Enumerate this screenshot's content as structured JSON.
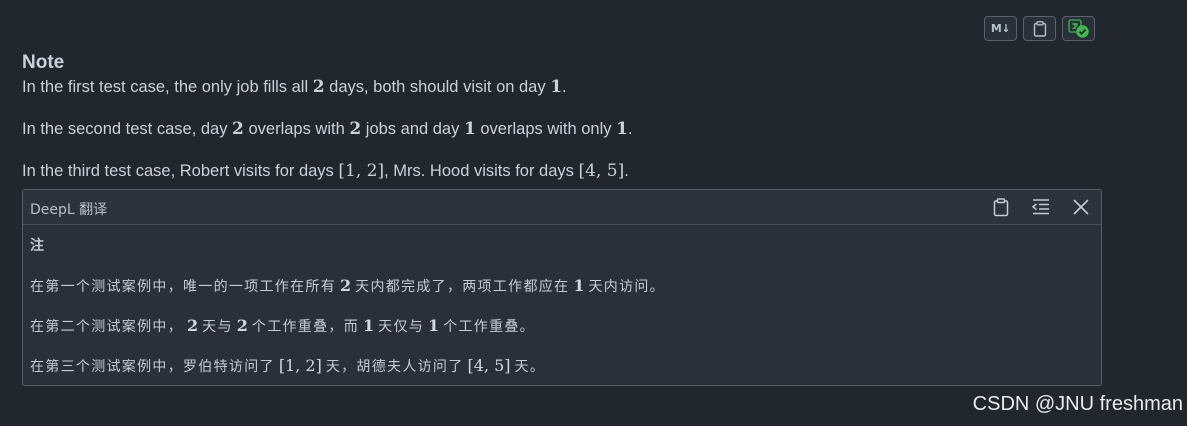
{
  "toolbar": {
    "markdown_label": "M↓",
    "copy_icon": "clipboard-icon",
    "translate_icon": "translate-check-icon"
  },
  "note": {
    "title": "Note",
    "p1": {
      "text_a": "In the first test case, the only job fills all ",
      "math_a": "2",
      "text_b": " days, both should visit on day ",
      "math_b": "1",
      "text_c": "."
    },
    "p2": {
      "text_a": "In the second test case, day ",
      "math_a": "2",
      "text_b": " overlaps with ",
      "math_b": "2",
      "text_c": " jobs and day ",
      "math_c": "1",
      "text_d": " overlaps with only ",
      "math_d": "1",
      "text_e": "."
    },
    "p3": {
      "text_a": "In the third test case, Robert visits for days ",
      "math_a": "[1, 2]",
      "text_b": ", Mrs. Hood visits for days ",
      "math_b": "[4, 5]",
      "text_c": "."
    }
  },
  "deepl": {
    "title": "DeepL 翻译",
    "icons": [
      "clipboard-icon",
      "indent-icon",
      "close-icon"
    ],
    "heading": "注",
    "l1": {
      "text_a": "在第一个测试案例中，唯一的一项工作在所有",
      "math_a": "2",
      "text_b": "天内都完成了，两项工作都应在",
      "math_b": "1",
      "text_c": "天内访问。"
    },
    "l2": {
      "text_a": "在第二个测试案例中，",
      "math_a": "2",
      "text_b": "天与",
      "math_b": "2",
      "text_c": "个工作重叠，而",
      "math_c": "1",
      "text_d": "天仅与",
      "math_d": "1",
      "text_e": "个工作重叠。"
    },
    "l3": {
      "text_a": "在第三个测试案例中，罗伯特访问了",
      "math_a": "[1, 2]",
      "text_b": "天，胡德夫人访问了",
      "math_b": "[4, 5]",
      "text_c": "天。"
    }
  },
  "watermark": "CSDN @JNU freshman",
  "colors": {
    "background": "#22262d",
    "panel": "#2b3038",
    "text": "#c9d1d9",
    "accent_green": "#3fb950"
  }
}
